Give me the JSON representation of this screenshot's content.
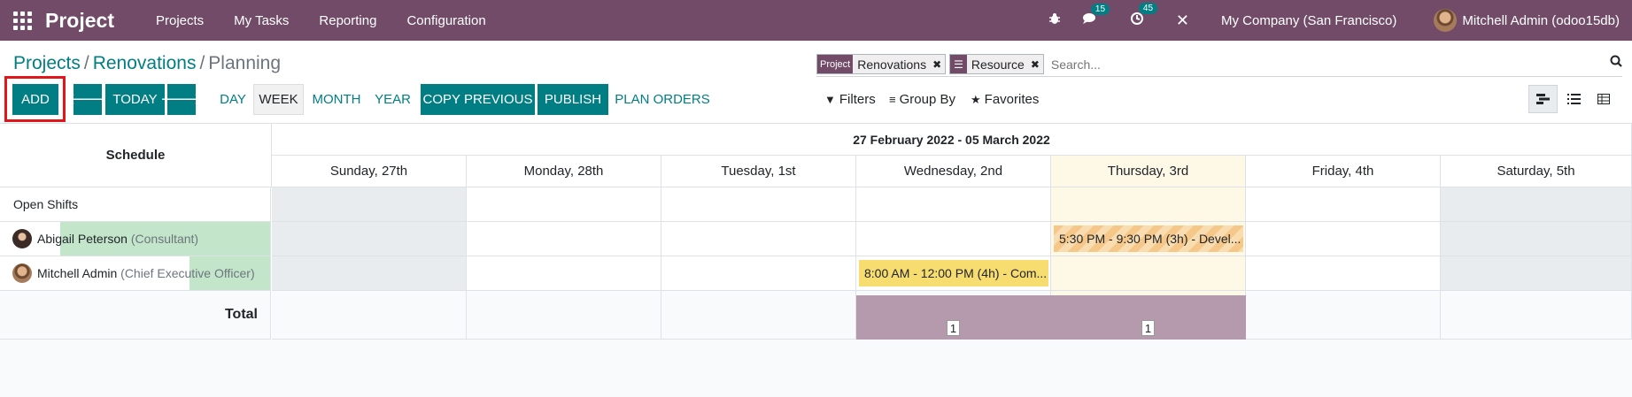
{
  "navbar": {
    "app_name": "Project",
    "menu": [
      "Projects",
      "My Tasks",
      "Reporting",
      "Configuration"
    ],
    "messages_count": "15",
    "activities_count": "45",
    "company": "My Company (San Francisco)",
    "user": "Mitchell Admin (odoo15db)"
  },
  "breadcrumb": {
    "items": [
      "Projects",
      "Renovations"
    ],
    "current": "Planning"
  },
  "search": {
    "facets": [
      {
        "label": "Project",
        "value": "Renovations"
      },
      {
        "label": "",
        "value": "Resource"
      }
    ],
    "placeholder": "Search..."
  },
  "buttons": {
    "add": "ADD",
    "today": "TODAY",
    "copy_previous": "COPY PREVIOUS",
    "publish": "PUBLISH",
    "plan_orders": "PLAN ORDERS"
  },
  "scales": [
    "DAY",
    "WEEK",
    "MONTH",
    "YEAR"
  ],
  "active_scale": "WEEK",
  "filters": {
    "filters": "Filters",
    "group_by": "Group By",
    "favorites": "Favorites"
  },
  "gantt": {
    "schedule_label": "Schedule",
    "range": "27 February 2022 - 05 March 2022",
    "days": [
      "Sunday, 27th",
      "Monday, 28th",
      "Tuesday, 1st",
      "Wednesday, 2nd",
      "Thursday, 3rd",
      "Friday, 4th",
      "Saturday, 5th"
    ],
    "rows": [
      {
        "name": "Open Shifts",
        "role": ""
      },
      {
        "name": "Abigail Peterson",
        "role": "(Consultant)"
      },
      {
        "name": "Mitchell Admin",
        "role": "(Chief Executive Officer)"
      }
    ],
    "pills": [
      {
        "text": "5:30 PM - 9:30 PM (3h) - Devel...",
        "row": 1,
        "day": 4
      },
      {
        "text": "8:00 AM - 12:00 PM (4h) - Com...",
        "row": 2,
        "day": 3
      }
    ],
    "total_label": "Total",
    "totals": [
      "",
      "",
      "",
      "1",
      "1",
      "",
      ""
    ]
  },
  "colors": {
    "brand": "#714b67",
    "accent": "#017e84",
    "today_bg": "#fef9e7",
    "weekend_bg": "#e9ecef",
    "pill_yellow": "#f7dc6f",
    "pill_striped": "#f5c88a",
    "total_bar": "#b59aae"
  }
}
